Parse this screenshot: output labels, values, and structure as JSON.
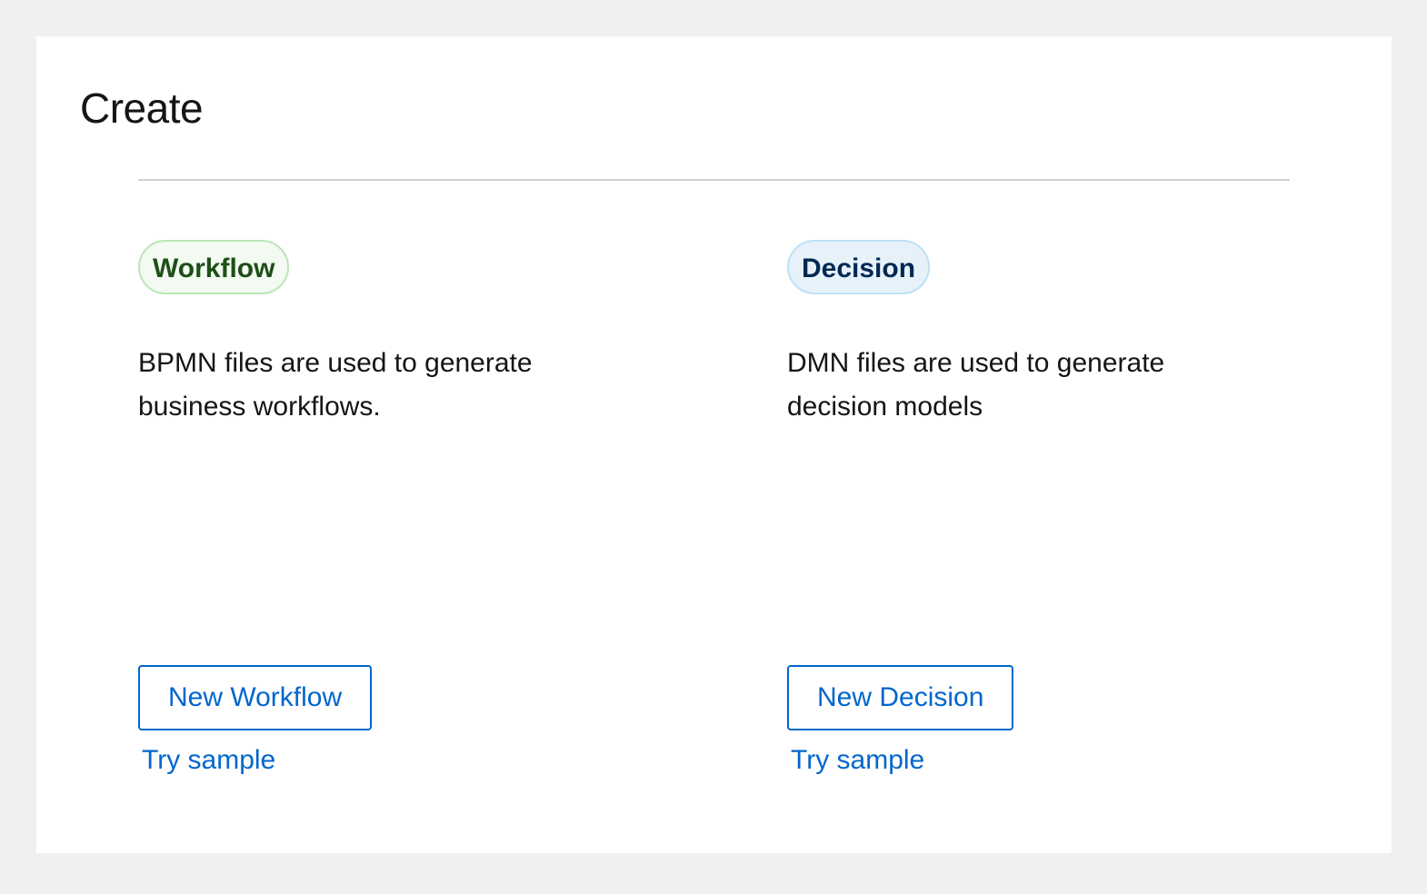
{
  "header": {
    "title": "Create"
  },
  "cards": [
    {
      "badge": "Workflow",
      "description_line1": "BPMN files are used to generate",
      "description_line2": "business workflows.",
      "button_label": "New Workflow",
      "link_label": "Try sample"
    },
    {
      "badge": "Decision",
      "description_line1": "DMN files are used to generate",
      "description_line2": "decision models",
      "button_label": "New Decision",
      "link_label": "Try sample"
    }
  ],
  "colors": {
    "background": "#f0f0f0",
    "card": "#ffffff",
    "link": "#0066cc",
    "workflow_badge_bg": "#f3faf2",
    "workflow_badge_text": "#1e4f18",
    "decision_badge_bg": "#e7f1fa",
    "decision_badge_text": "#002952"
  }
}
